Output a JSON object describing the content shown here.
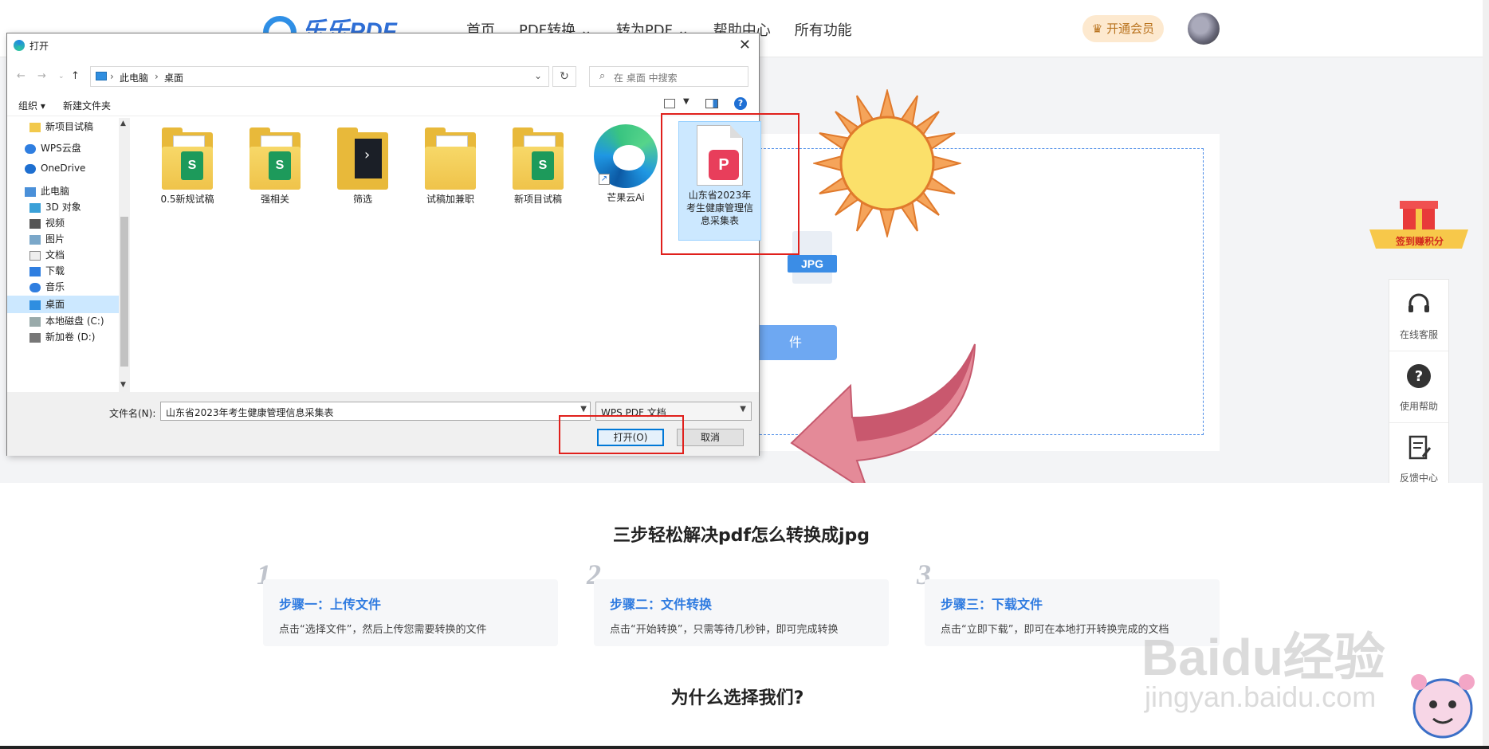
{
  "website": {
    "logo": "乐乐PDF",
    "nav": [
      "首页",
      "PDF转换 ⌄",
      "转为PDF ⌄",
      "帮助中心",
      "所有功能"
    ],
    "vip_label": "开通会员",
    "upload": {
      "file_type_tag": "JPG",
      "select_button_partial": "件"
    },
    "steps_title": "三步轻松解决pdf怎么转换成jpg",
    "steps": [
      {
        "num": "1",
        "title": "步骤一：上传文件",
        "desc": "点击“选择文件”，然后上传您需要转换的文件"
      },
      {
        "num": "2",
        "title": "步骤二：文件转换",
        "desc": "点击“开始转换”，只需等待几秒钟，即可完成转换"
      },
      {
        "num": "3",
        "title": "步骤三：下载文件",
        "desc": "点击“立即下载”，即可在本地打开转换完成的文档"
      }
    ],
    "why_title": "为什么选择我们?",
    "gift_label": "签到赚积分",
    "side_rail": [
      {
        "label": "在线客服",
        "icon": "headset-icon"
      },
      {
        "label": "使用帮助",
        "icon": "question-icon"
      },
      {
        "label": "反馈中心",
        "icon": "feedback-icon"
      }
    ],
    "watermark": "Baidu经验",
    "watermark_url": "jingyan.baidu.com"
  },
  "dialog": {
    "title": "打开",
    "close": "✕",
    "address": {
      "root": "此电脑",
      "current": "桌面"
    },
    "search_placeholder": "在 桌面 中搜索",
    "toolbar": {
      "organize": "组织 ▾",
      "new_folder": "新建文件夹",
      "help": "?"
    },
    "tree": [
      {
        "label": "新项目试稿",
        "icon": "folder-icon",
        "selected": false
      },
      {
        "label": "WPS云盘",
        "icon": "cloud-icon",
        "selected": false
      },
      {
        "label": "OneDrive",
        "icon": "onedrive-icon",
        "selected": false
      },
      {
        "label": "此电脑",
        "icon": "computer-icon",
        "selected": false
      },
      {
        "label": "3D 对象",
        "icon": "3d-objects-icon",
        "selected": false
      },
      {
        "label": "视频",
        "icon": "video-icon",
        "selected": false
      },
      {
        "label": "图片",
        "icon": "pictures-icon",
        "selected": false
      },
      {
        "label": "文档",
        "icon": "documents-icon",
        "selected": false
      },
      {
        "label": "下载",
        "icon": "download-icon",
        "selected": false
      },
      {
        "label": "音乐",
        "icon": "music-icon",
        "selected": false
      },
      {
        "label": "桌面",
        "icon": "desktop-icon",
        "selected": true
      },
      {
        "label": "本地磁盘 (C:)",
        "icon": "drive-icon",
        "selected": false
      },
      {
        "label": "新加卷 (D:)",
        "icon": "drive-icon",
        "selected": false
      }
    ],
    "files": [
      {
        "label": "0.5新规试稿",
        "kind": "folder-sheet"
      },
      {
        "label": "强相关",
        "kind": "folder-sheet"
      },
      {
        "label": "筛选",
        "kind": "folder-dark"
      },
      {
        "label": "试稿加兼职",
        "kind": "folder-plain"
      },
      {
        "label": "新项目试稿",
        "kind": "folder-sheet"
      },
      {
        "label": "芒果云Ai",
        "kind": "edge-shortcut"
      },
      {
        "label": "山东省2023年考生健康管理信息采集表",
        "kind": "pdf",
        "selected": true
      }
    ],
    "filename_label": "文件名(N):",
    "filename_value": "山东省2023年考生健康管理信息采集表",
    "filetype_value": "WPS PDF 文档",
    "open_button": "打开(O)",
    "cancel_button": "取消"
  },
  "colors": {
    "accent": "#2f7be0",
    "highlight": "#e0201c",
    "selection": "#cce8ff"
  }
}
